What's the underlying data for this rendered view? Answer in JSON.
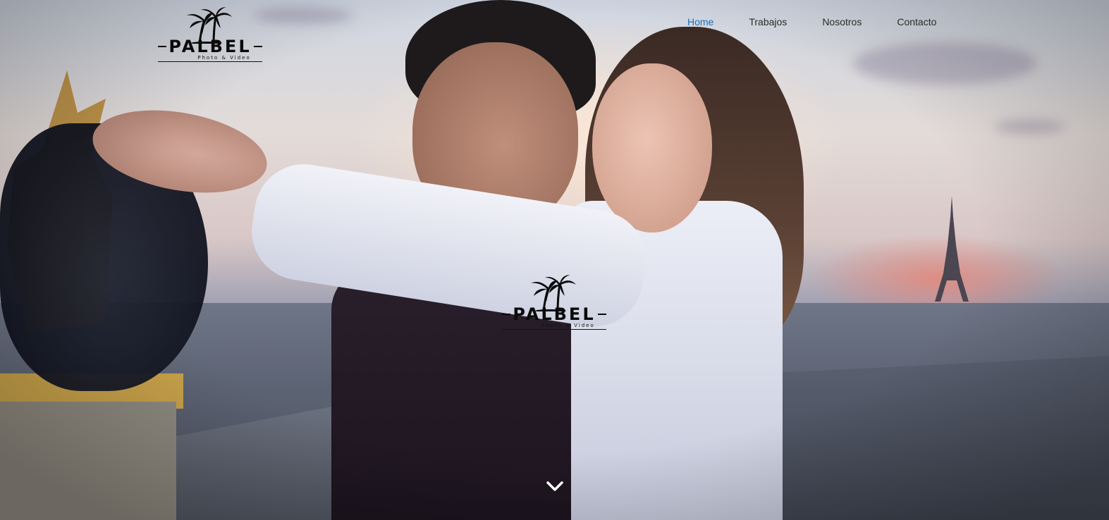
{
  "brand": {
    "name": "PALBEL",
    "tagline": "Photo & Video"
  },
  "nav": {
    "items": [
      {
        "label": "Home",
        "active": true
      },
      {
        "label": "Trabajos",
        "active": false
      },
      {
        "label": "Nosotros",
        "active": false
      },
      {
        "label": "Contacto",
        "active": false
      }
    ]
  },
  "hero": {
    "background": "couple-on-paris-rooftop-photo",
    "scroll_icon": "chevron-down-icon"
  },
  "colors": {
    "nav_active": "#1d6fb8",
    "nav_text": "#2b2b2b",
    "logo": "#0a0a0a"
  }
}
